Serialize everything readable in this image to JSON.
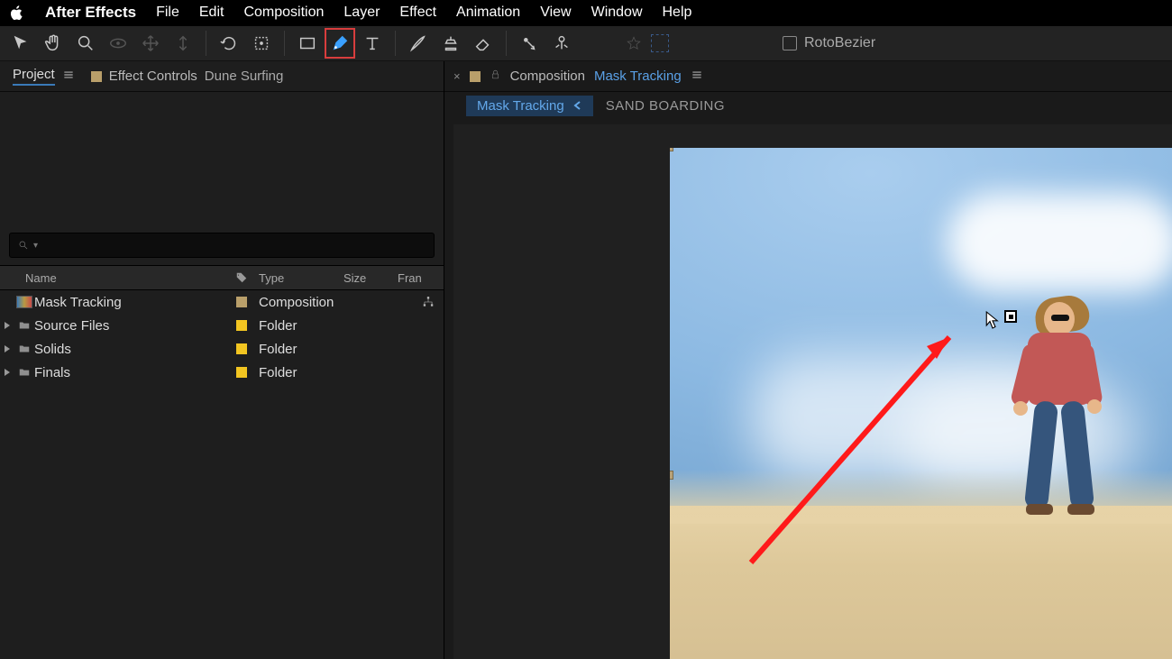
{
  "menubar": {
    "app": "After Effects",
    "items": [
      "File",
      "Edit",
      "Composition",
      "Layer",
      "Effect",
      "Animation",
      "View",
      "Window",
      "Help"
    ]
  },
  "toolbar": {
    "rotobezier_label": "RotoBezier"
  },
  "projectPanel": {
    "tabs": {
      "project": "Project",
      "effectControls": "Effect Controls",
      "ecSuffix": "Dune Surfing"
    },
    "search": {
      "placeholder": ""
    },
    "columns": {
      "name": "Name",
      "type": "Type",
      "size": "Size",
      "frame": "Fran"
    },
    "rows": [
      {
        "name": "Mask Tracking",
        "type": "Composition",
        "color": "beige",
        "icon": "comp",
        "expandable": false,
        "flow": true
      },
      {
        "name": "Source Files",
        "type": "Folder",
        "color": "yellow",
        "icon": "folder",
        "expandable": true
      },
      {
        "name": "Solids",
        "type": "Folder",
        "color": "yellow",
        "icon": "folder",
        "expandable": true
      },
      {
        "name": "Finals",
        "type": "Folder",
        "color": "yellow",
        "icon": "folder",
        "expandable": true
      }
    ]
  },
  "compPanel": {
    "label": "Composition",
    "name": "Mask Tracking",
    "breadcrumb": {
      "active": "Mask Tracking",
      "next": "SAND BOARDING"
    }
  }
}
